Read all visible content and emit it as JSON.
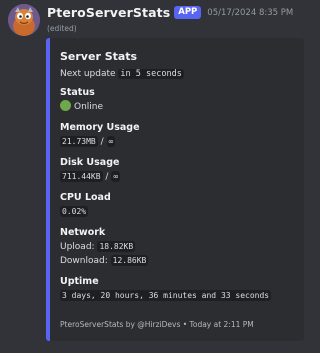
{
  "message": {
    "username": "PteroServerStats",
    "badge": "APP",
    "timestamp": "05/17/2024 8:35 PM",
    "edited": "(edited)"
  },
  "embed": {
    "accent_color": "#5865f2",
    "title": "Server Stats",
    "next_update_label": "Next update",
    "next_update_value": "in 5 seconds",
    "status": {
      "name": "Status",
      "icon": "green-circle-icon",
      "value": "Online"
    },
    "memory": {
      "name": "Memory Usage",
      "used": "21.73MB",
      "sep": "/",
      "total": "∞"
    },
    "disk": {
      "name": "Disk Usage",
      "used": "711.44KB",
      "sep": "/",
      "total": "∞"
    },
    "cpu": {
      "name": "CPU Load",
      "value": "0.02%"
    },
    "network": {
      "name": "Network",
      "upload_label": "Upload:",
      "upload_value": "18.82KB",
      "download_label": "Download:",
      "download_value": "12.86KB"
    },
    "uptime": {
      "name": "Uptime",
      "value": "3 days, 20 hours, 36 minutes and 33 seconds"
    },
    "footer": "PteroServerStats by @HirziDevs • Today at 2:11 PM"
  }
}
